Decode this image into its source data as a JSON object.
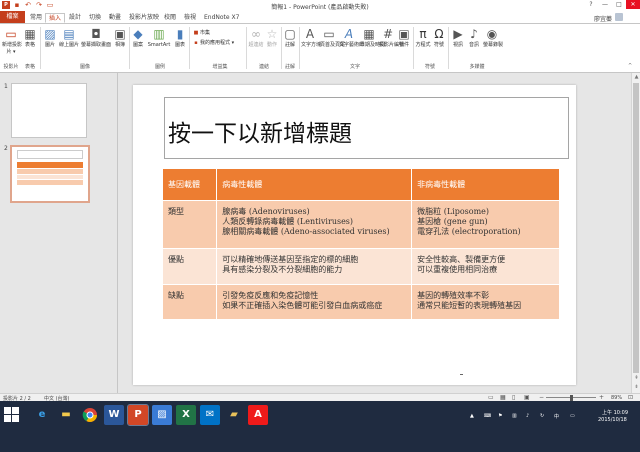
{
  "window": {
    "title": "簡報1 - PowerPoint (產品啟動失敗)",
    "controls": [
      "?",
      "—",
      "□",
      "✕"
    ]
  },
  "quick_access": {
    "icons": [
      "save-icon",
      "undo-icon",
      "redo-icon",
      "start-from-beginning-icon"
    ]
  },
  "tabs": [
    "檔案",
    "常用",
    "插入",
    "設計",
    "切換",
    "動畫",
    "投影片放映",
    "校閱",
    "檢視",
    "EndNote X7"
  ],
  "active_tab": "插入",
  "user": {
    "name": "廖宜蓁"
  },
  "ribbon": {
    "new_slide": [
      "新增投影",
      "片 ▾"
    ],
    "table": "表格",
    "images": [
      "圖片",
      "線上圖片",
      "螢幕擷取畫面",
      "相簿"
    ],
    "illustrations": [
      "圖案",
      "SmartArt",
      "圖表"
    ],
    "store": "市集",
    "my_apps": "我的應用程式 ▾",
    "links": [
      "超連結",
      "動作"
    ],
    "comment": "註解",
    "text": [
      "文字方塊",
      "頁首及頁尾",
      "文字藝術師",
      "日期及時間",
      "投影片編號",
      "物件"
    ],
    "symbols": [
      "方程式",
      "符號"
    ],
    "media": [
      "視訊",
      "音訊",
      "螢幕錄製"
    ],
    "group_labels": [
      "投影片",
      "表格",
      "圖像",
      "圖例",
      "增益集",
      "連結",
      "註解",
      "文字",
      "符號",
      "多媒體"
    ]
  },
  "thumbnails": {
    "numbers": [
      "1",
      "2"
    ]
  },
  "slide": {
    "title_placeholder": "按一下以新增標題",
    "table": {
      "headers": [
        "基因載體",
        "病毒性載體",
        "非病毒性載體"
      ],
      "rows": [
        {
          "label": "類型",
          "viral": [
            "腺病毒 (Adenoviruses)",
            "人類反轉錄病毒載體 (Lentiviruses)",
            "腺相關病毒載體 (Adeno-associated viruses)"
          ],
          "nonviral": [
            "微脂粒 (Liposome)",
            "基因槍 (gene gun)",
            "電穿孔法 (electroporation)"
          ]
        },
        {
          "label": "優點",
          "viral": [
            "可以精確地傳送基因至指定的標的細胞",
            "具有感染分裂及不分裂細胞的能力"
          ],
          "nonviral": [
            "安全性較高、製備更方便",
            "可以重複使用相同治療"
          ]
        },
        {
          "label": "缺點",
          "viral": [
            "引發免疫反應和免疫記憶性",
            "如果不正確插入染色體可能引發白血病或癌症"
          ],
          "nonviral": [
            "基因的轉殖效率不彰",
            "通常只能短暫的表現轉殖基因"
          ]
        }
      ]
    }
  },
  "statusbar": {
    "slide_info": "投影片 2 / 2",
    "language": "中文 (台灣)",
    "zoom": "89%"
  },
  "taskbar": {
    "apps": [
      "ie-icon",
      "file-explorer-icon",
      "chrome-icon",
      "word-icon",
      "powerpoint-icon",
      "photos-icon",
      "excel-icon",
      "outlook-icon",
      "folder-icon",
      "acrobat-icon"
    ],
    "ime": "中",
    "time": "上午 10:09",
    "date": "2015/10/18"
  },
  "colors": {
    "accent": "#c43e1c",
    "table_header": "#ed7d31",
    "row_dark": "#f8cbad",
    "row_light": "#fbe4d5",
    "taskbar": "#1f2b40"
  }
}
